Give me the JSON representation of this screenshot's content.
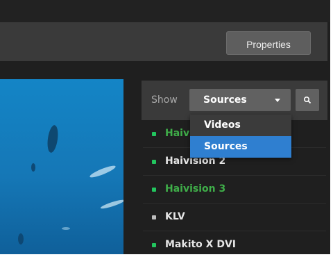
{
  "toolbar": {
    "properties_label": "Properties"
  },
  "filter": {
    "show_label": "Show",
    "selected": "Sources",
    "options": [
      "Videos",
      "Sources"
    ],
    "highlighted_option": "Sources"
  },
  "sources": [
    {
      "label": "Haivision 1",
      "status_color": "#22c55e",
      "label_color": "#3fae49"
    },
    {
      "label": "Haivision 2",
      "status_color": "#22c55e",
      "label_color": "#e6e6e6"
    },
    {
      "label": "Haivision 3",
      "status_color": "#22c55e",
      "label_color": "#3fae49"
    },
    {
      "label": "KLV",
      "status_color": "#bdbdbd",
      "label_color": "#e6e6e6"
    },
    {
      "label": "Makito X DVI",
      "status_color": "#22c55e",
      "label_color": "#e6e6e6"
    }
  ],
  "colors": {
    "accent_highlight": "#2f7fd0",
    "panel_dark": "#1f1f1f",
    "toolbar": "#3a3a3a"
  }
}
